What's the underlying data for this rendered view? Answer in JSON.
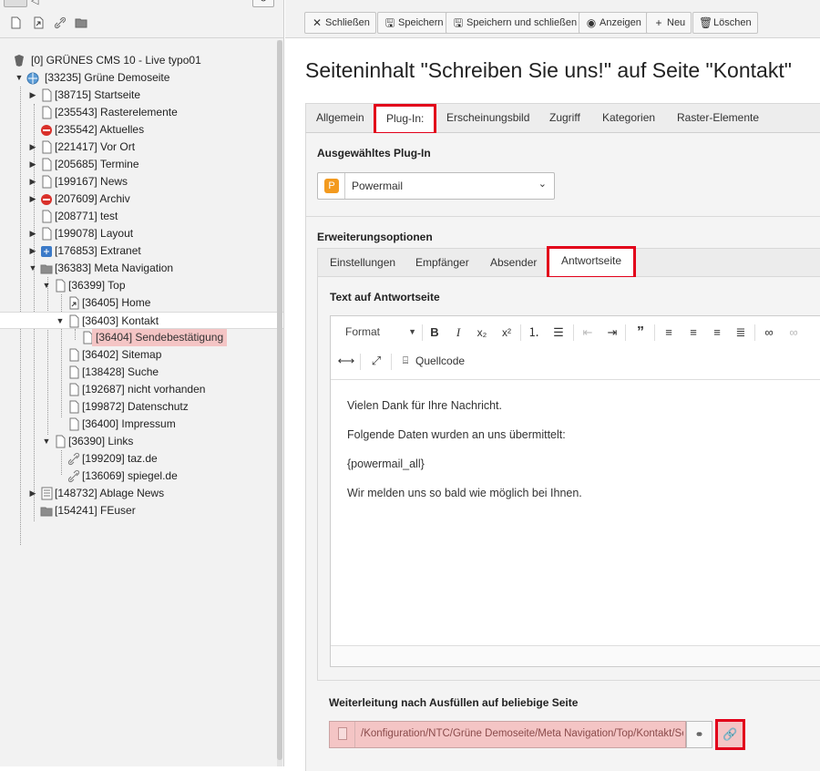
{
  "left_toolbar": {
    "icons": [
      "new-page-icon",
      "shortcut-page-icon",
      "link-icon",
      "folder-icon"
    ],
    "refresh_icon": "refresh-icon"
  },
  "tree": {
    "root": "[0] GRÜNES CMS 10 - Live typo01",
    "items": [
      {
        "label": "[33235] Grüne Demoseite"
      },
      {
        "label": "[38715] Startseite"
      },
      {
        "label": "[235543] Rasterelemente"
      },
      {
        "label": "[235542] Aktuelles"
      },
      {
        "label": "[221417] Vor Ort"
      },
      {
        "label": "[205685] Termine"
      },
      {
        "label": "[199167] News"
      },
      {
        "label": "[207609] Archiv"
      },
      {
        "label": "[208771] test"
      },
      {
        "label": "[199078] Layout"
      },
      {
        "label": "[176853] Extranet"
      },
      {
        "label": "[36383] Meta Navigation"
      },
      {
        "label": "[36399] Top"
      },
      {
        "label": "[36405] Home"
      },
      {
        "label": "[36403] Kontakt"
      },
      {
        "label": "[36404] Sendebestätigung"
      },
      {
        "label": "[36402] Sitemap"
      },
      {
        "label": "[138428] Suche"
      },
      {
        "label": "[192687] nicht vorhanden"
      },
      {
        "label": "[199872] Datenschutz"
      },
      {
        "label": "[36400] Impressum"
      },
      {
        "label": "[36390] Links"
      },
      {
        "label": "[199209] taz.de"
      },
      {
        "label": "[136069] spiegel.de"
      },
      {
        "label": "[148732] Ablage News"
      },
      {
        "label": "[154241] FEuser"
      }
    ]
  },
  "toolbar": {
    "close": "Schließen",
    "save": "Speichern",
    "save_close": "Speichern und schließen",
    "view": "Anzeigen",
    "new": "Neu",
    "delete": "Löschen"
  },
  "page_title": "Seiteninhalt \"Schreiben Sie uns!\" auf Seite \"Kontakt\"",
  "tabs": [
    "Allgemein",
    "Plug-In:",
    "Erscheinungsbild",
    "Zugriff",
    "Kategorien",
    "Raster-Elemente"
  ],
  "plugin": {
    "heading": "Ausgewähltes Plug-In",
    "selected": "Powermail"
  },
  "extension": {
    "heading": "Erweiterungsoptionen",
    "tabs": [
      "Einstellungen",
      "Empfänger",
      "Absender",
      "Antwortseite"
    ],
    "text_heading": "Text auf Antwortseite"
  },
  "editor": {
    "format_label": "Format",
    "source_label": "Quellcode",
    "paragraphs": [
      "Vielen Dank für Ihre Nachricht.",
      "Folgende Daten wurden an uns übermittelt:",
      "{powermail_all}",
      "Wir melden uns so bald wie möglich bei Ihnen."
    ]
  },
  "redirect": {
    "heading": "Weiterleitung nach Ausfüllen auf beliebige Seite",
    "value": "/Konfiguration/NTC/Grüne Demoseite/Meta Navigation/Top/Kontakt/Se"
  },
  "colors": {
    "highlight": "#e2001a",
    "selection": "#f4c5c5",
    "plugin_icon": "#f39a1e"
  }
}
